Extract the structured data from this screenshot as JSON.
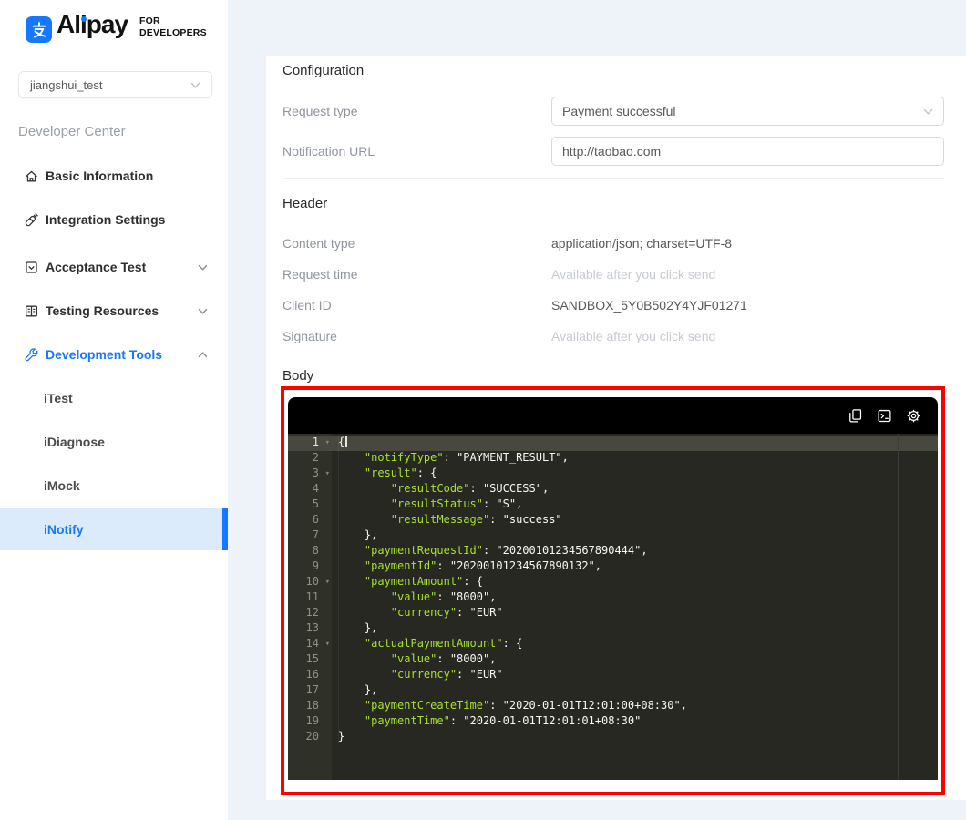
{
  "brand": {
    "name": "Alipay",
    "logo_icon": "alipay-zhi-glyph",
    "tagline_line1": "FOR",
    "tagline_line2": "DEVELOPERS"
  },
  "account_select": {
    "value": "jiangshui_test",
    "chevron_icon": "chevron-down-icon"
  },
  "sidebar": {
    "section_title": "Developer Center",
    "items": [
      {
        "label": "Basic Information",
        "icon": "home"
      },
      {
        "label": "Integration Settings",
        "icon": "plug"
      },
      {
        "label": "Acceptance Test",
        "icon": "checkbox",
        "chevron": "down"
      },
      {
        "label": "Testing Resources",
        "icon": "book",
        "chevron": "down"
      },
      {
        "label": "Development Tools",
        "icon": "wrench",
        "chevron": "up",
        "active": true
      },
      {
        "label": "iTest",
        "sub": true
      },
      {
        "label": "iDiagnose",
        "sub": true
      },
      {
        "label": "iMock",
        "sub": true
      },
      {
        "label": "iNotify",
        "sub": true,
        "active": true
      }
    ]
  },
  "config": {
    "title": "Configuration",
    "request_type_label": "Request type",
    "request_type_value": "Payment successful",
    "notification_url_label": "Notification URL",
    "notification_url_value": "http://taobao.com"
  },
  "header_section": {
    "title": "Header",
    "rows": [
      {
        "label": "Content type",
        "value": "application/json; charset=UTF-8",
        "muted": false
      },
      {
        "label": "Request time",
        "value": "Available after you click send",
        "muted": true
      },
      {
        "label": "Client ID",
        "value": "SANDBOX_5Y0B502Y4YJF01271",
        "muted": false
      },
      {
        "label": "Signature",
        "value": "Available after you click send",
        "muted": true
      }
    ]
  },
  "body_section": {
    "title": "Body",
    "toolbar_icons": [
      "copy",
      "terminal",
      "settings"
    ],
    "editor_colors": {
      "background": "#272822",
      "gutter": "#2f3129",
      "active_line": "#49483e",
      "key": "#a6e22e",
      "text": "#f8f8f2",
      "line_number": "#90908a",
      "highlight_border": "#fd0100"
    },
    "code": {
      "lines": [
        {
          "n": 1,
          "indent": 0,
          "fold": true,
          "active": true,
          "segments": [
            {
              "t": "punct",
              "v": "{"
            }
          ]
        },
        {
          "n": 2,
          "indent": 1,
          "segments": [
            {
              "t": "key",
              "v": "\"notifyType\""
            },
            {
              "t": "punct",
              "v": ": "
            },
            {
              "t": "str",
              "v": "\"PAYMENT_RESULT\""
            },
            {
              "t": "punct",
              "v": ","
            }
          ]
        },
        {
          "n": 3,
          "indent": 1,
          "fold": true,
          "segments": [
            {
              "t": "key",
              "v": "\"result\""
            },
            {
              "t": "punct",
              "v": ": {"
            }
          ]
        },
        {
          "n": 4,
          "indent": 2,
          "segments": [
            {
              "t": "key",
              "v": "\"resultCode\""
            },
            {
              "t": "punct",
              "v": ": "
            },
            {
              "t": "str",
              "v": "\"SUCCESS\""
            },
            {
              "t": "punct",
              "v": ","
            }
          ]
        },
        {
          "n": 5,
          "indent": 2,
          "segments": [
            {
              "t": "key",
              "v": "\"resultStatus\""
            },
            {
              "t": "punct",
              "v": ": "
            },
            {
              "t": "str",
              "v": "\"S\""
            },
            {
              "t": "punct",
              "v": ","
            }
          ]
        },
        {
          "n": 6,
          "indent": 2,
          "segments": [
            {
              "t": "key",
              "v": "\"resultMessage\""
            },
            {
              "t": "punct",
              "v": ": "
            },
            {
              "t": "str",
              "v": "\"success\""
            }
          ]
        },
        {
          "n": 7,
          "indent": 1,
          "segments": [
            {
              "t": "punct",
              "v": "},"
            }
          ]
        },
        {
          "n": 8,
          "indent": 1,
          "segments": [
            {
              "t": "key",
              "v": "\"paymentRequestId\""
            },
            {
              "t": "punct",
              "v": ": "
            },
            {
              "t": "str",
              "v": "\"20200101234567890444\""
            },
            {
              "t": "punct",
              "v": ","
            }
          ]
        },
        {
          "n": 9,
          "indent": 1,
          "segments": [
            {
              "t": "key",
              "v": "\"paymentId\""
            },
            {
              "t": "punct",
              "v": ": "
            },
            {
              "t": "str",
              "v": "\"20200101234567890132\""
            },
            {
              "t": "punct",
              "v": ","
            }
          ]
        },
        {
          "n": 10,
          "indent": 1,
          "fold": true,
          "segments": [
            {
              "t": "key",
              "v": "\"paymentAmount\""
            },
            {
              "t": "punct",
              "v": ": {"
            }
          ]
        },
        {
          "n": 11,
          "indent": 2,
          "segments": [
            {
              "t": "key",
              "v": "\"value\""
            },
            {
              "t": "punct",
              "v": ": "
            },
            {
              "t": "str",
              "v": "\"8000\""
            },
            {
              "t": "punct",
              "v": ","
            }
          ]
        },
        {
          "n": 12,
          "indent": 2,
          "segments": [
            {
              "t": "key",
              "v": "\"currency\""
            },
            {
              "t": "punct",
              "v": ": "
            },
            {
              "t": "str",
              "v": "\"EUR\""
            }
          ]
        },
        {
          "n": 13,
          "indent": 1,
          "segments": [
            {
              "t": "punct",
              "v": "},"
            }
          ]
        },
        {
          "n": 14,
          "indent": 1,
          "fold": true,
          "segments": [
            {
              "t": "key",
              "v": "\"actualPaymentAmount\""
            },
            {
              "t": "punct",
              "v": ": {"
            }
          ]
        },
        {
          "n": 15,
          "indent": 2,
          "segments": [
            {
              "t": "key",
              "v": "\"value\""
            },
            {
              "t": "punct",
              "v": ": "
            },
            {
              "t": "str",
              "v": "\"8000\""
            },
            {
              "t": "punct",
              "v": ","
            }
          ]
        },
        {
          "n": 16,
          "indent": 2,
          "segments": [
            {
              "t": "key",
              "v": "\"currency\""
            },
            {
              "t": "punct",
              "v": ": "
            },
            {
              "t": "str",
              "v": "\"EUR\""
            }
          ]
        },
        {
          "n": 17,
          "indent": 1,
          "segments": [
            {
              "t": "punct",
              "v": "},"
            }
          ]
        },
        {
          "n": 18,
          "indent": 1,
          "segments": [
            {
              "t": "key",
              "v": "\"paymentCreateTime\""
            },
            {
              "t": "punct",
              "v": ": "
            },
            {
              "t": "str",
              "v": "\"2020-01-01T12:01:00+08:30\""
            },
            {
              "t": "punct",
              "v": ","
            }
          ]
        },
        {
          "n": 19,
          "indent": 1,
          "segments": [
            {
              "t": "key",
              "v": "\"paymentTime\""
            },
            {
              "t": "punct",
              "v": ": "
            },
            {
              "t": "str",
              "v": "\"2020-01-01T12:01:01+08:30\""
            }
          ]
        },
        {
          "n": 20,
          "indent": 0,
          "segments": [
            {
              "t": "punct",
              "v": "}"
            }
          ]
        }
      ]
    }
  },
  "colors": {
    "accent_blue": "#1677ff",
    "active_item_bg": "#dcebfb",
    "page_bg": "#eef2f9"
  }
}
